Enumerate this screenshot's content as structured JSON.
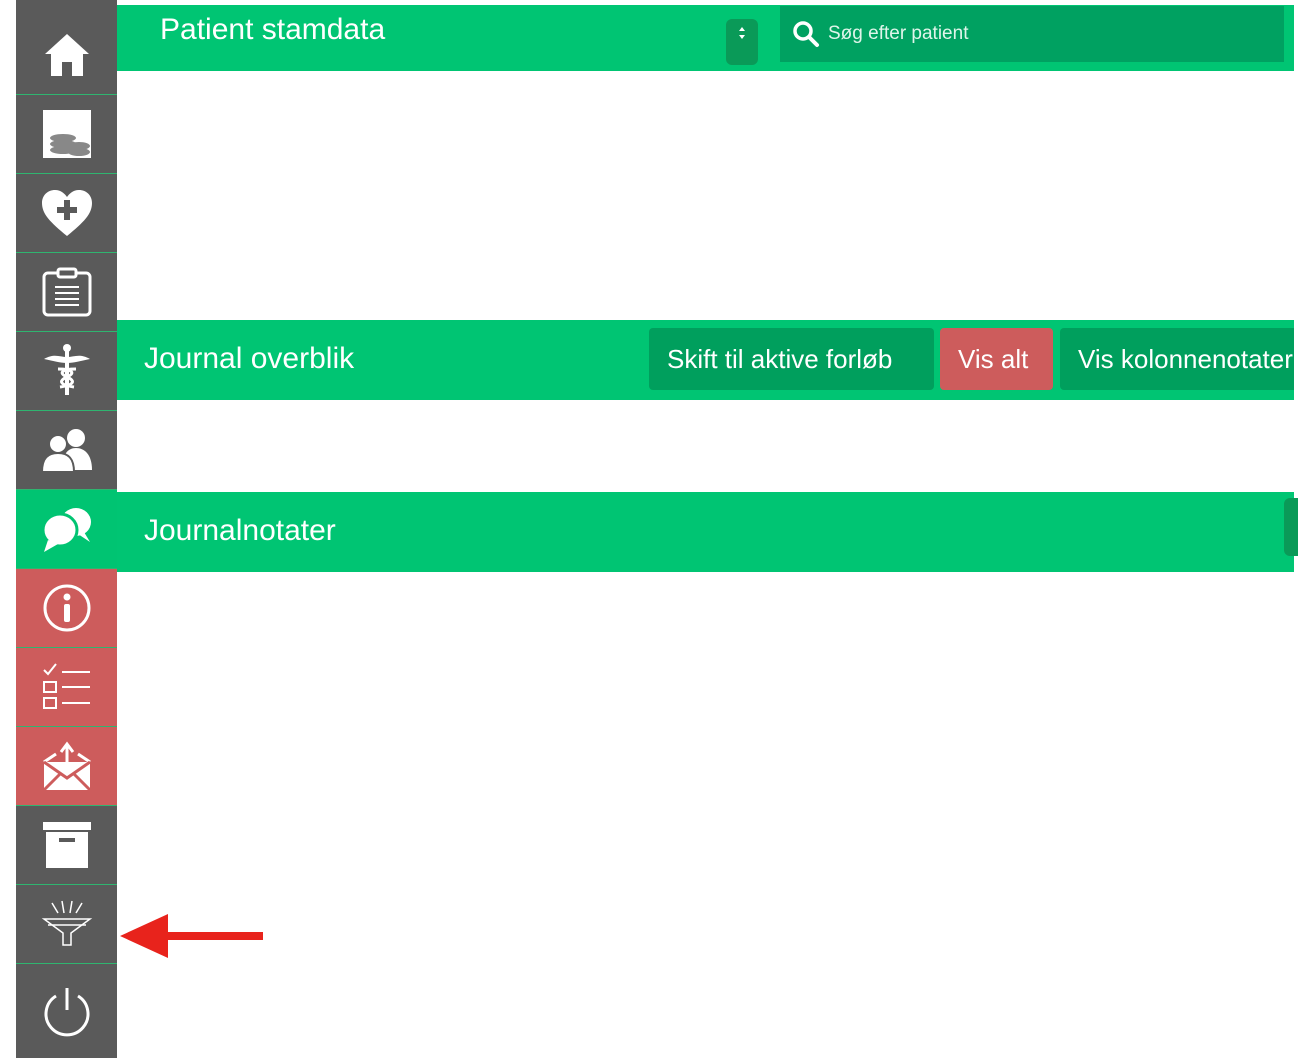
{
  "header": {
    "title": "Patient stamdata",
    "search_placeholder": "Søg efter patient"
  },
  "overview": {
    "title": "Journal overblik",
    "buttons": [
      "Skift til aktive forløb",
      "Vis alt",
      "Vis kolonnenotater"
    ]
  },
  "notes": {
    "title": "Journalnotater"
  },
  "sidebar": {
    "items": [
      {
        "icon": "home-icon",
        "state": "default"
      },
      {
        "icon": "coins-icon",
        "state": "default"
      },
      {
        "icon": "heart-plus-icon",
        "state": "default"
      },
      {
        "icon": "clipboard-icon",
        "state": "default"
      },
      {
        "icon": "caduceus-icon",
        "state": "default"
      },
      {
        "icon": "users-icon",
        "state": "default"
      },
      {
        "icon": "chat-bubbles-icon",
        "state": "active"
      },
      {
        "icon": "info-icon",
        "state": "alert"
      },
      {
        "icon": "checklist-icon",
        "state": "alert"
      },
      {
        "icon": "mail-upload-icon",
        "state": "alert"
      },
      {
        "icon": "archive-icon",
        "state": "default"
      },
      {
        "icon": "funnel-icon",
        "state": "default"
      },
      {
        "icon": "power-icon",
        "state": "default"
      }
    ]
  },
  "colors": {
    "brand_green": "#00c573",
    "dark_green": "#009f5d",
    "alert_red": "#cd5c5c",
    "sidebar_gray": "#5a5a5a",
    "annotation_arrow": "#e8231c"
  }
}
